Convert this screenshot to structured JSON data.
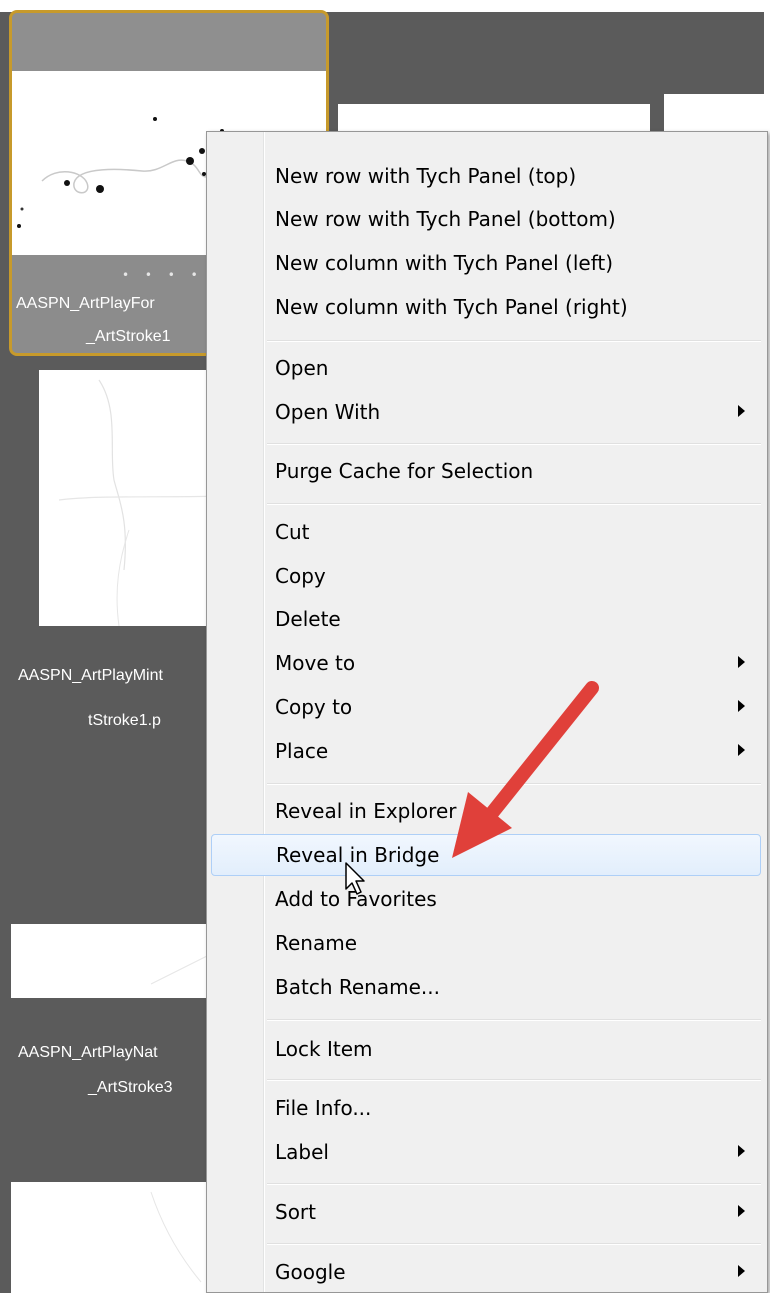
{
  "thumbnails": [
    {
      "caption_line1": "AASPN_ArtPlayFor",
      "caption_line2": "_ArtStroke1",
      "selected": true
    },
    {
      "caption_line1": "AASPN_ArtPlayMint",
      "caption_line2": "tStroke1.p",
      "selected": false
    },
    {
      "caption_line1": "AASPN_ArtPlayNat",
      "caption_line2": "_ArtStroke3",
      "selected": false
    }
  ],
  "context_menu": {
    "items": [
      {
        "label": "New row with Tych Panel (top)",
        "submenu": false
      },
      {
        "label": "New row with Tych Panel (bottom)",
        "submenu": false
      },
      {
        "label": "New column with Tych Panel (left)",
        "submenu": false
      },
      {
        "label": "New column with Tych Panel (right)",
        "submenu": false
      },
      {
        "label": "Open",
        "submenu": false
      },
      {
        "label": "Open With",
        "submenu": true
      },
      {
        "label": "Purge Cache for Selection",
        "submenu": false
      },
      {
        "label": "Cut",
        "submenu": false
      },
      {
        "label": "Copy",
        "submenu": false
      },
      {
        "label": "Delete",
        "submenu": false
      },
      {
        "label": "Move to",
        "submenu": true
      },
      {
        "label": "Copy to",
        "submenu": true
      },
      {
        "label": "Place",
        "submenu": true
      },
      {
        "label": "Reveal in Explorer",
        "submenu": false
      },
      {
        "label": "Reveal in Bridge",
        "submenu": false,
        "highlighted": true
      },
      {
        "label": "Add to Favorites",
        "submenu": false
      },
      {
        "label": "Rename",
        "submenu": false
      },
      {
        "label": "Batch Rename...",
        "submenu": false
      },
      {
        "label": "Lock Item",
        "submenu": false
      },
      {
        "label": "File Info...",
        "submenu": false
      },
      {
        "label": "Label",
        "submenu": true
      },
      {
        "label": "Sort",
        "submenu": true
      },
      {
        "label": "Google",
        "submenu": true
      }
    ]
  },
  "annotation": {
    "arrow_color": "#e0403a",
    "cursor_icon": "pointer-cursor-icon"
  },
  "colors": {
    "selection_border": "#c79a2b",
    "highlight_border": "#aecff7",
    "panel_bg": "#5b5b5b"
  }
}
